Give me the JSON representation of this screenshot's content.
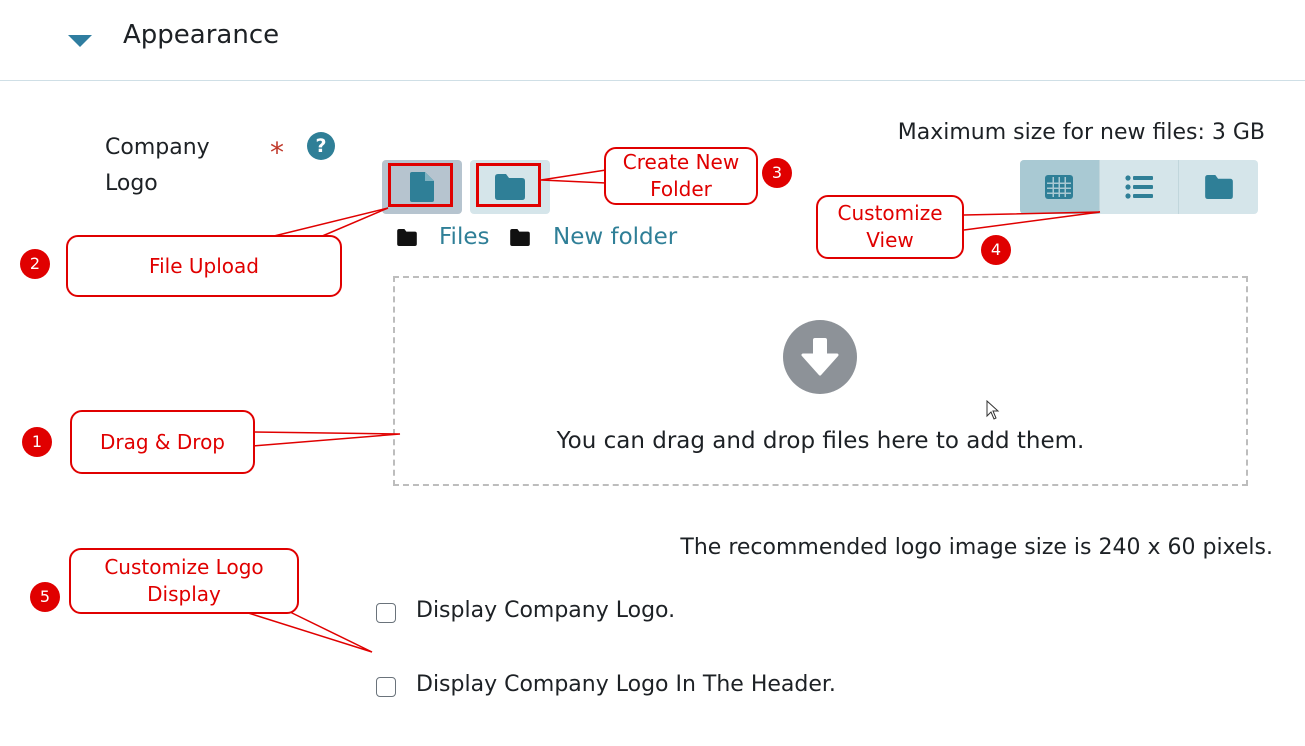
{
  "section": {
    "title": "Appearance"
  },
  "field": {
    "label": "Company Logo",
    "required_marker": "*",
    "help_icon": "?"
  },
  "filepicker": {
    "max_size_text": "Maximum size for new files: 3 GB",
    "upload_button_icon": "file-icon",
    "new_folder_button_icon": "folder-icon",
    "view_modes": [
      "grid-icon",
      "list-icon",
      "folder-tree-icon"
    ],
    "active_view": "grid",
    "breadcrumb": [
      "Files",
      "New folder"
    ],
    "drop_text": "You can drag and drop files here to add them."
  },
  "recommendation": "The recommended logo image size is 240 x 60 pixels.",
  "checkboxes": [
    {
      "label": "Display Company Logo.",
      "checked": false
    },
    {
      "label": "Display Company Logo In The Header.",
      "checked": false
    }
  ],
  "annotations": {
    "create_new_folder": "Create New Folder",
    "file_upload": "File Upload",
    "customize_view": "Customize View",
    "drag_drop": "Drag & Drop",
    "customize_logo_display": "Customize Logo Display",
    "badges": [
      "1",
      "2",
      "3",
      "4",
      "5"
    ]
  },
  "colors": {
    "accent": "#2f7f97",
    "annotation": "#e00000",
    "required": "#c0392b"
  }
}
